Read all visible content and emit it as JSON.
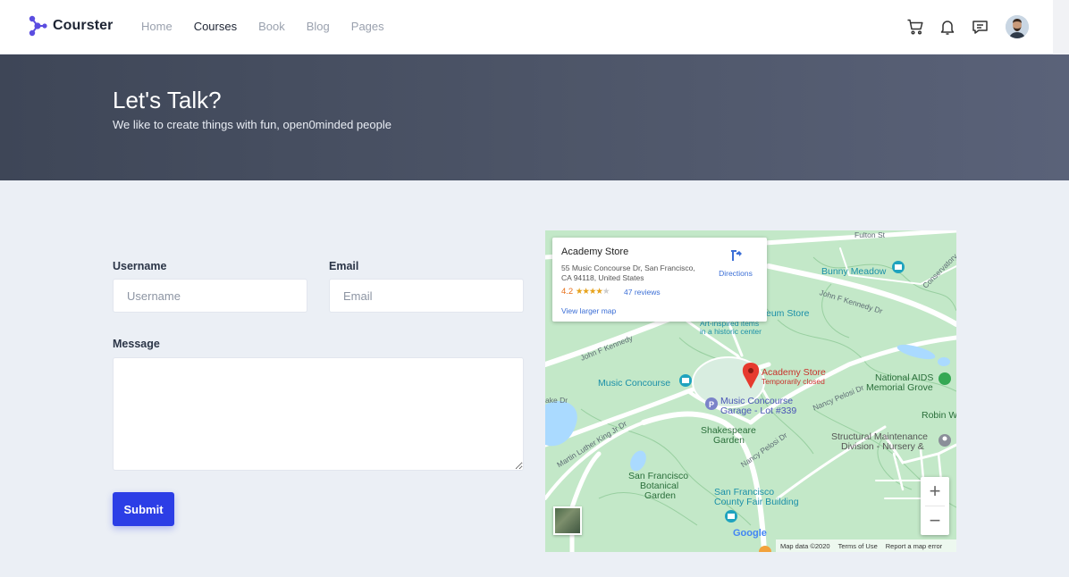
{
  "brand": {
    "name": "Courster",
    "accent": "#2c3ee6",
    "logo_color": "#5b4de0"
  },
  "nav": {
    "items": [
      {
        "label": "Home",
        "active": false
      },
      {
        "label": "Courses",
        "active": true
      },
      {
        "label": "Book",
        "active": false
      },
      {
        "label": "Blog",
        "active": false
      },
      {
        "label": "Pages",
        "active": false
      }
    ]
  },
  "header_icons": [
    "cart-icon",
    "bell-icon",
    "message-icon",
    "avatar"
  ],
  "hero": {
    "title": "Let's Talk?",
    "subtitle": "We like to create things with fun, open0minded people"
  },
  "form": {
    "username_label": "Username",
    "username_placeholder": "Username",
    "username_value": "",
    "email_label": "Email",
    "email_placeholder": "Email",
    "email_value": "",
    "message_label": "Message",
    "message_value": "",
    "submit_label": "Submit"
  },
  "map": {
    "card": {
      "title": "Academy Store",
      "address": "55 Music Concourse Dr, San Francisco, CA 94118, United States",
      "rating": "4.2",
      "stars": 4,
      "reviews": "47 reviews",
      "directions": "Directions",
      "larger_map": "View larger map"
    },
    "labels": {
      "fulton": "Fulton St",
      "bunny": "Bunny Meadow",
      "jfk_right": "John F Kennedy Dr",
      "jfk_left": "John F Kennedy",
      "conservatory": "Conservatory",
      "museum": "eum Store",
      "art": "Art-inspired items",
      "art2": "in a historic center",
      "music_concourse": "Music Concourse",
      "academy": "Academy Store",
      "closed": "Temporarily closed",
      "garage": "Music Concourse",
      "garage2": "Garage - Lot #339",
      "aids": "National AIDS",
      "aids2": "Memorial Grove",
      "nancy_pelosi": "Nancy Pelosi Dr",
      "mlk": "Martin Luther King Jr Dr",
      "shakespeare": "Shakespeare",
      "shakespeare2": "Garden",
      "robin": "Robin W",
      "structural": "Structural Maintenance",
      "structural2": "Division - Nursery &",
      "botanical": "San Francisco",
      "botanical2": "Botanical",
      "botanical3": "Garden",
      "fair": "San Francisco",
      "fair2": "County Fair Building",
      "lake": "ake Dr",
      "nancy2": "Nancy Pelosi Dr",
      "google": "Google",
      "mapdata": "Map data ©2020",
      "terms": "Terms of Use",
      "report": "Report a map error"
    },
    "zoom_in": "+",
    "zoom_out": "−"
  }
}
